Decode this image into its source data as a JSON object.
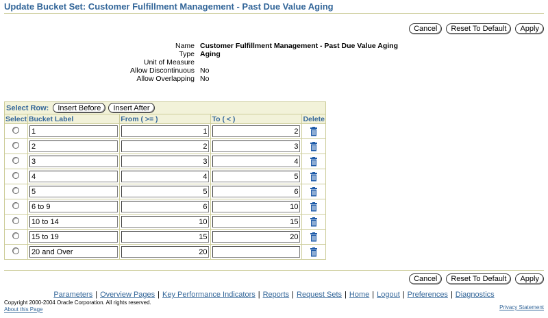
{
  "page": {
    "title": "Update Bucket Set: Customer Fulfillment Management - Past Due Value Aging"
  },
  "buttons": {
    "cancel": "Cancel",
    "reset": "Reset To Default",
    "apply": "Apply"
  },
  "info": [
    {
      "label": "Name",
      "value": "Customer Fulfillment Management - Past Due Value Aging",
      "bold": true
    },
    {
      "label": "Type",
      "value": "Aging",
      "bold": true
    },
    {
      "label": "Unit of Measure",
      "value": "",
      "bold": false
    },
    {
      "label": "Allow Discontinuous",
      "value": "No",
      "bold": false
    },
    {
      "label": "Allow Overlapping",
      "value": "No",
      "bold": false
    }
  ],
  "table": {
    "select_row_label": "Select Row:",
    "insert_before": "Insert Before",
    "insert_after": "Insert After",
    "headers": {
      "select": "Select",
      "label": "Bucket Label",
      "from": "From ( >= )",
      "to": "To ( < )",
      "delete": "Delete"
    },
    "rows": [
      {
        "label": "1",
        "from": "1",
        "to": "2"
      },
      {
        "label": "2",
        "from": "2",
        "to": "3"
      },
      {
        "label": "3",
        "from": "3",
        "to": "4"
      },
      {
        "label": "4",
        "from": "4",
        "to": "5"
      },
      {
        "label": "5",
        "from": "5",
        "to": "6"
      },
      {
        "label": "6 to 9",
        "from": "6",
        "to": "10"
      },
      {
        "label": "10 to 14",
        "from": "10",
        "to": "15"
      },
      {
        "label": "15 to 19",
        "from": "15",
        "to": "20"
      },
      {
        "label": "20 and Over",
        "from": "20",
        "to": ""
      }
    ]
  },
  "footer": {
    "links": [
      "Parameters",
      "Overview Pages",
      "Key Performance Indicators",
      "Reports",
      "Request Sets",
      "Home",
      "Logout",
      "Preferences",
      "Diagnostics"
    ],
    "copyright": "Copyright 2000-2004 Oracle Corporation. All rights reserved.",
    "about": "About this Page",
    "privacy": "Privacy Statement"
  },
  "colors": {
    "accent": "#336699",
    "header_bg": "#f2f2d9",
    "border": "#cccc99",
    "trash": "#1e5ba8"
  },
  "icons": {
    "delete": "trash-icon"
  }
}
